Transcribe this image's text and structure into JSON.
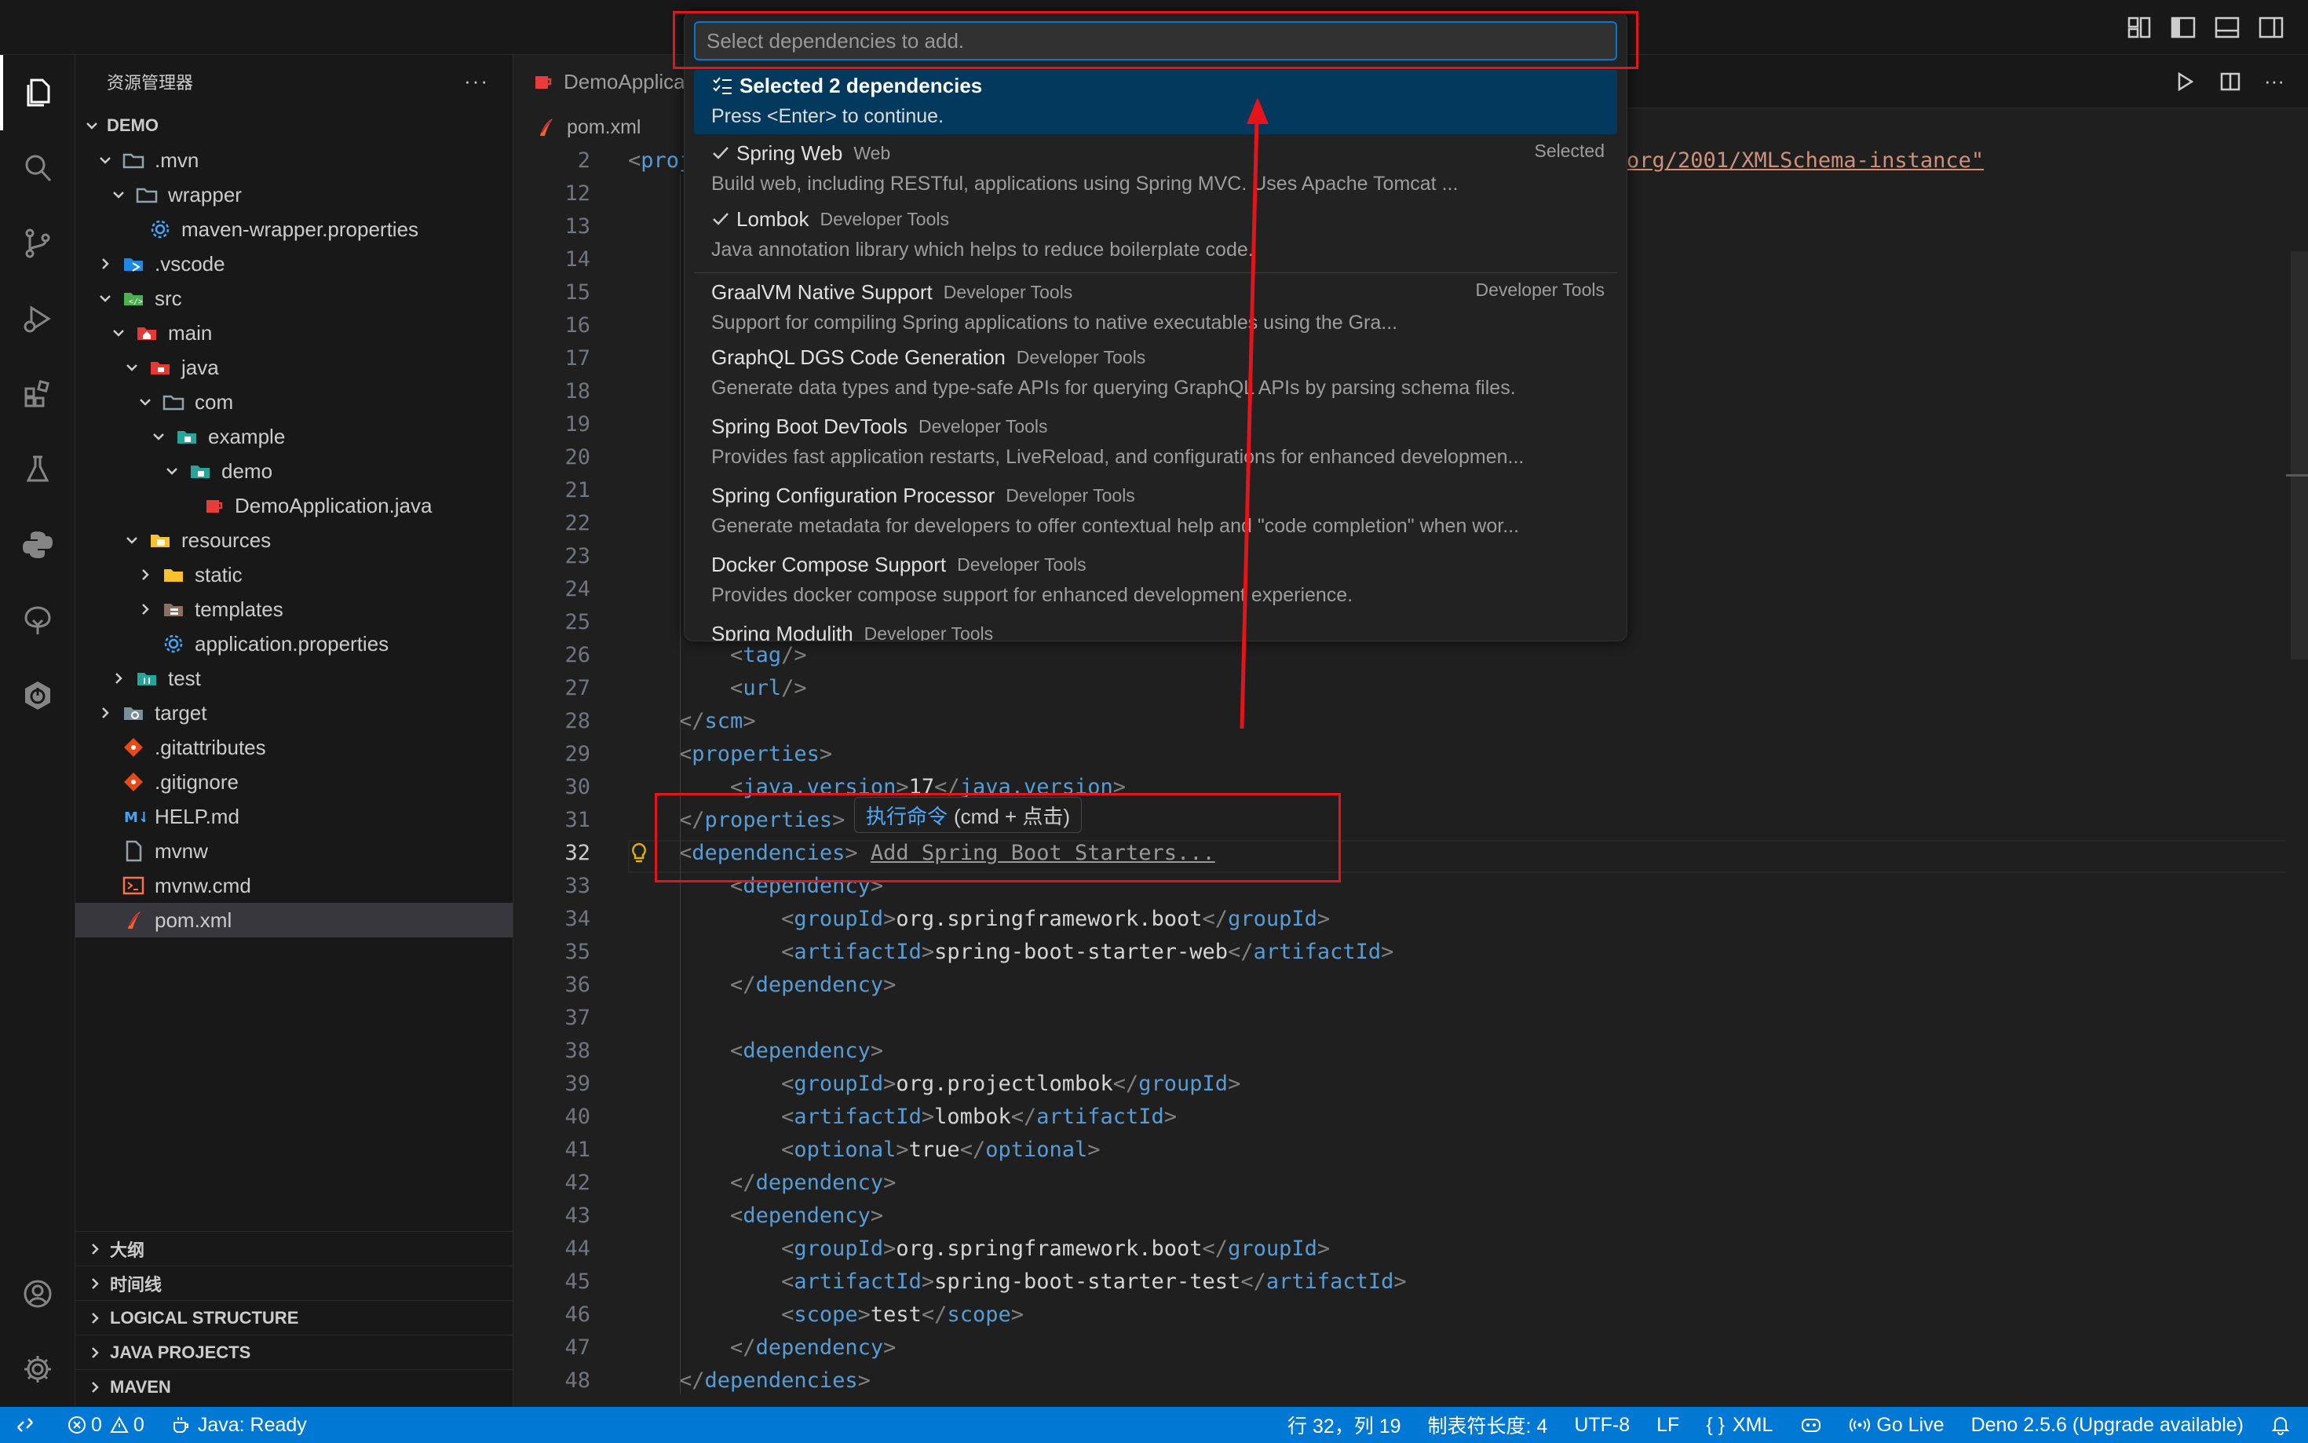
{
  "quickpick": {
    "placeholder": "Select dependencies to add.",
    "items": [
      {
        "title": "Selected 2 dependencies",
        "detail": "Press <Enter> to continue.",
        "focused": true
      },
      {
        "title": "Spring Web",
        "category": "Web",
        "right": "Selected",
        "detail": "Build web, including RESTful, applications using Spring MVC. Uses Apache Tomcat ...",
        "checked": true
      },
      {
        "title": "Lombok",
        "category": "Developer Tools",
        "detail": "Java annotation library which helps to reduce boilerplate code.",
        "checked": true
      },
      {
        "title": "GraalVM Native Support",
        "category": "Developer Tools",
        "right": "Developer Tools",
        "detail": "Support for compiling Spring applications to native executables using the Gra..."
      },
      {
        "title": "GraphQL DGS Code Generation",
        "category": "Developer Tools",
        "detail": "Generate data types and type-safe APIs for querying GraphQL APIs by parsing schema files."
      },
      {
        "title": "Spring Boot DevTools",
        "category": "Developer Tools",
        "detail": "Provides fast application restarts, LiveReload, and configurations for enhanced developmen..."
      },
      {
        "title": "Spring Configuration Processor",
        "category": "Developer Tools",
        "detail": "Generate metadata for developers to offer contextual help and \"code completion\" when wor..."
      },
      {
        "title": "Docker Compose Support",
        "category": "Developer Tools",
        "detail": "Provides docker compose support for enhanced development experience."
      },
      {
        "title": "Spring Modulith",
        "category": "Developer Tools",
        "detail": ""
      }
    ]
  },
  "sidebar": {
    "title": "资源管理器",
    "more": "···",
    "root": "DEMO",
    "tree": [
      {
        "label": ".mvn",
        "depth": 1,
        "chev": "down",
        "icon": "folder-icon"
      },
      {
        "label": "wrapper",
        "depth": 2,
        "chev": "down",
        "icon": "folder-icon"
      },
      {
        "label": "maven-wrapper.properties",
        "depth": 3,
        "chev": "",
        "icon": "gear-icon"
      },
      {
        "label": ".vscode",
        "depth": 1,
        "chev": "right",
        "icon": "vscode-folder-icon"
      },
      {
        "label": "src",
        "depth": 1,
        "chev": "down",
        "icon": "src-folder-icon"
      },
      {
        "label": "main",
        "depth": 2,
        "chev": "down",
        "icon": "main-folder-icon"
      },
      {
        "label": "java",
        "depth": 3,
        "chev": "down",
        "icon": "java-folder-icon"
      },
      {
        "label": "com",
        "depth": 4,
        "chev": "down",
        "icon": "folder-icon"
      },
      {
        "label": "example",
        "depth": 5,
        "chev": "down",
        "icon": "package-folder-icon"
      },
      {
        "label": "demo",
        "depth": 6,
        "chev": "down",
        "icon": "package-folder-icon"
      },
      {
        "label": "DemoApplication.java",
        "depth": 7,
        "chev": "",
        "icon": "java-file-icon"
      },
      {
        "label": "resources",
        "depth": 3,
        "chev": "down",
        "icon": "resources-folder-icon"
      },
      {
        "label": "static",
        "depth": 4,
        "chev": "right",
        "icon": "static-folder-icon"
      },
      {
        "label": "templates",
        "depth": 4,
        "chev": "right",
        "icon": "templates-folder-icon"
      },
      {
        "label": "application.properties",
        "depth": 4,
        "chev": "",
        "icon": "gear-icon"
      },
      {
        "label": "test",
        "depth": 2,
        "chev": "right",
        "icon": "test-folder-icon"
      },
      {
        "label": "target",
        "depth": 1,
        "chev": "right",
        "icon": "target-folder-icon"
      },
      {
        "label": ".gitattributes",
        "depth": 1,
        "chev": "",
        "icon": "git-icon"
      },
      {
        "label": ".gitignore",
        "depth": 1,
        "chev": "",
        "icon": "git-icon"
      },
      {
        "label": "HELP.md",
        "depth": 1,
        "chev": "",
        "icon": "markdown-icon"
      },
      {
        "label": "mvnw",
        "depth": 1,
        "chev": "",
        "icon": "file-icon"
      },
      {
        "label": "mvnw.cmd",
        "depth": 1,
        "chev": "",
        "icon": "terminal-file-icon"
      },
      {
        "label": "pom.xml",
        "depth": 1,
        "chev": "",
        "icon": "maven-icon",
        "selected": true
      }
    ],
    "sections": [
      "大纲",
      "时间线",
      "LOGICAL STRUCTURE",
      "JAVA PROJECTS",
      "MAVEN"
    ]
  },
  "editor": {
    "tab": "DemoApplica",
    "breadcrumb": "pom.xml",
    "line2_right": "org/2001/XMLSchema-instance\"",
    "line_numbers": [
      "2",
      "12",
      "13",
      "14",
      "15",
      "16",
      "17",
      "18",
      "19",
      "20",
      "21",
      "22",
      "23",
      "24",
      "25",
      "26",
      "27",
      "28",
      "29",
      "30",
      "31",
      "32",
      "33",
      "34",
      "35",
      "36",
      "37",
      "38",
      "39",
      "40",
      "41",
      "42",
      "43",
      "44",
      "45",
      "46",
      "47",
      "48"
    ],
    "current_line": "32",
    "codelens": "Add Spring Boot Starters...",
    "hover_link": "执行命令",
    "hover_text": "(cmd + 点击)",
    "java_version": "17"
  },
  "statusbar": {
    "errors": "0",
    "warnings": "0",
    "java": "Java: Ready",
    "position": "行 32，列 19",
    "indent": "制表符长度: 4",
    "encoding": "UTF-8",
    "eol": "LF",
    "language": "XML",
    "golive": "Go Live",
    "deno": "Deno 2.5.6 (Upgrade available)"
  },
  "colors": {
    "accent": "#0078d4",
    "annotation": "#e3141a",
    "focus_row": "#04395e"
  }
}
